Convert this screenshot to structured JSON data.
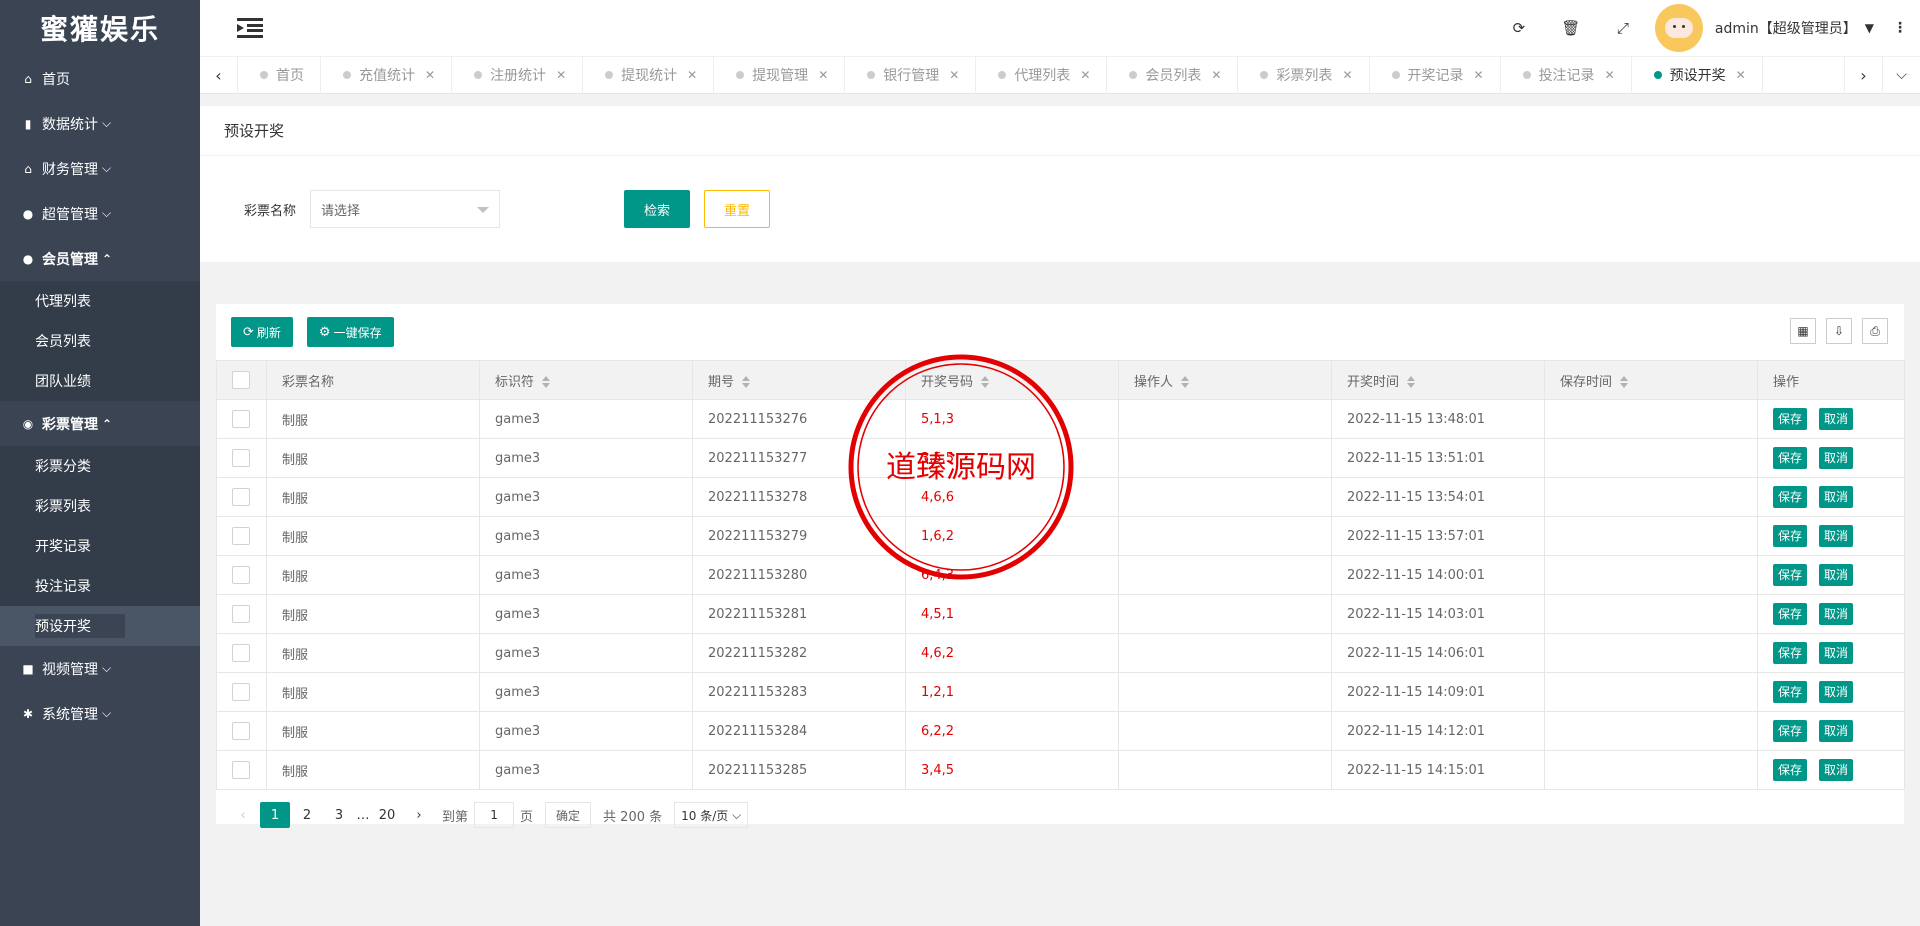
{
  "app": {
    "title": "蜜獾娱乐"
  },
  "sidebar": {
    "items": [
      {
        "label": "首页",
        "icon": "home-icon",
        "glyph": "⌂"
      },
      {
        "label": "数据统计",
        "icon": "bar-chart-icon",
        "glyph": "▮"
      },
      {
        "label": "财务管理",
        "icon": "bank-icon",
        "glyph": "⌂"
      },
      {
        "label": "超管管理",
        "icon": "user-icon",
        "glyph": "●"
      },
      {
        "label": "会员管理",
        "icon": "users-icon",
        "glyph": "●"
      },
      {
        "label": "彩票管理",
        "icon": "gamepad-icon",
        "glyph": "◉"
      },
      {
        "label": "视频管理",
        "icon": "video-icon",
        "glyph": "■"
      },
      {
        "label": "系统管理",
        "icon": "gear-icon",
        "glyph": "✱"
      }
    ],
    "member_sub": [
      "代理列表",
      "会员列表",
      "团队业绩"
    ],
    "lottery_sub": [
      "彩票分类",
      "彩票列表",
      "开奖记录",
      "投注记录",
      "预设开奖"
    ]
  },
  "header": {
    "user": "admin【超级管理员】"
  },
  "tabs": [
    "首页",
    "充值统计",
    "注册统计",
    "提现统计",
    "提现管理",
    "银行管理",
    "代理列表",
    "会员列表",
    "彩票列表",
    "开奖记录",
    "投注记录",
    "预设开奖"
  ],
  "search": {
    "title": "预设开奖",
    "label": "彩票名称",
    "placeholder": "请选择",
    "search_btn": "检索",
    "reset_btn": "重置"
  },
  "toolbar": {
    "refresh": "刷新",
    "save_all": "一键保存"
  },
  "table": {
    "columns": [
      "彩票名称",
      "标识符",
      "期号",
      "开奖号码",
      "操作人",
      "开奖时间",
      "保存时间",
      "操作"
    ],
    "save_label": "保存",
    "cancel_label": "取消",
    "rows": [
      {
        "name": "制服",
        "id": "game3",
        "issue": "202211153276",
        "num": "5,1,3",
        "op": "",
        "time": "2022-11-15 13:48:01",
        "saved": ""
      },
      {
        "name": "制服",
        "id": "game3",
        "issue": "202211153277",
        "num": "3,5,5",
        "op": "",
        "time": "2022-11-15 13:51:01",
        "saved": ""
      },
      {
        "name": "制服",
        "id": "game3",
        "issue": "202211153278",
        "num": "4,6,6",
        "op": "",
        "time": "2022-11-15 13:54:01",
        "saved": ""
      },
      {
        "name": "制服",
        "id": "game3",
        "issue": "202211153279",
        "num": "1,6,2",
        "op": "",
        "time": "2022-11-15 13:57:01",
        "saved": ""
      },
      {
        "name": "制服",
        "id": "game3",
        "issue": "202211153280",
        "num": "6,4,3",
        "op": "",
        "time": "2022-11-15 14:00:01",
        "saved": ""
      },
      {
        "name": "制服",
        "id": "game3",
        "issue": "202211153281",
        "num": "4,5,1",
        "op": "",
        "time": "2022-11-15 14:03:01",
        "saved": ""
      },
      {
        "name": "制服",
        "id": "game3",
        "issue": "202211153282",
        "num": "4,6,2",
        "op": "",
        "time": "2022-11-15 14:06:01",
        "saved": ""
      },
      {
        "name": "制服",
        "id": "game3",
        "issue": "202211153283",
        "num": "1,2,1",
        "op": "",
        "time": "2022-11-15 14:09:01",
        "saved": ""
      },
      {
        "name": "制服",
        "id": "game3",
        "issue": "202211153284",
        "num": "6,2,2",
        "op": "",
        "time": "2022-11-15 14:12:01",
        "saved": ""
      },
      {
        "name": "制服",
        "id": "game3",
        "issue": "202211153285",
        "num": "3,4,5",
        "op": "",
        "time": "2022-11-15 14:15:01",
        "saved": ""
      }
    ]
  },
  "pager": {
    "pages": [
      "1",
      "2",
      "3",
      "…",
      "20"
    ],
    "goto_label": "到第",
    "goto_value": "1",
    "page_unit": "页",
    "confirm": "确定",
    "total": "共 200 条",
    "per_page": "10 条/页"
  },
  "watermark": {
    "text": "道臻源码网"
  },
  "colors": {
    "primary": "#009688",
    "warning": "#ffb800",
    "sidebar": "#3a4453",
    "number": "#e30000"
  }
}
